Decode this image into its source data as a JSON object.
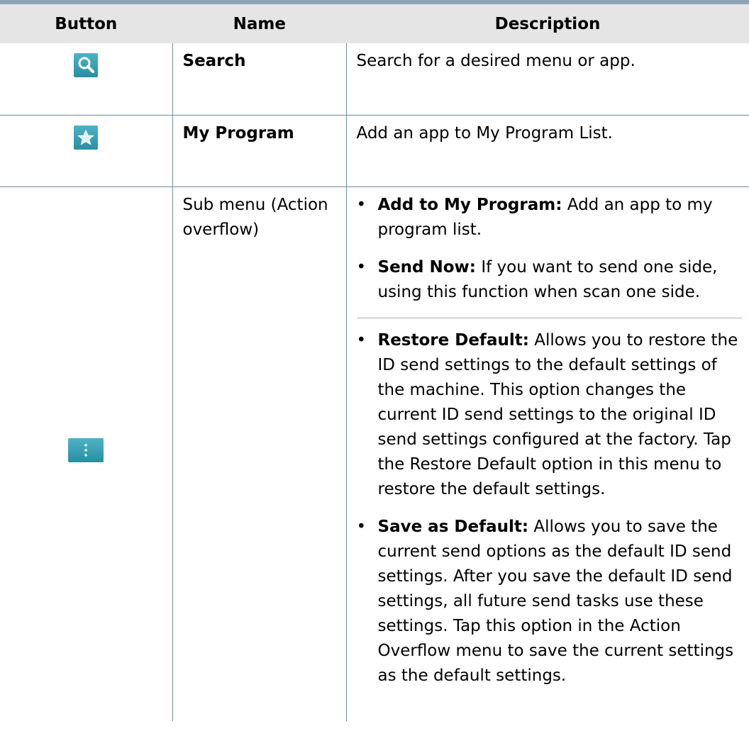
{
  "header": {
    "col_button": "Button",
    "col_name": "Name",
    "col_description": "Description"
  },
  "rows": [
    {
      "icon": "search-icon",
      "name": "Search",
      "description": "Search for a desired menu or app."
    },
    {
      "icon": "star-icon",
      "name": "My Program",
      "description": "Add an app to My Program List."
    },
    {
      "icon": "overflow-dots-icon",
      "name": "Sub menu (Action overflow)",
      "items": [
        {
          "label": "Add to My Program:",
          "text": " Add an app to my program list."
        },
        {
          "label": "Send Now:",
          "text": "  If you want to send one side, using this function when scan one side."
        },
        {
          "label": "Restore Default:",
          "text": " Allows you to restore the ID send settings to the default settings of the machine. This option changes the current ID send settings to the original ID send settings configured at the factory. Tap the Restore Default option in this menu to restore the default settings."
        },
        {
          "label": "Save as Default:",
          "text": " Allows you to save the current send options as the default ID send settings. After you save the default ID send settings, all future send tasks use these settings. Tap this option in the Action Overflow menu to save the current settings as the default settings."
        }
      ]
    }
  ],
  "bullet": "•"
}
